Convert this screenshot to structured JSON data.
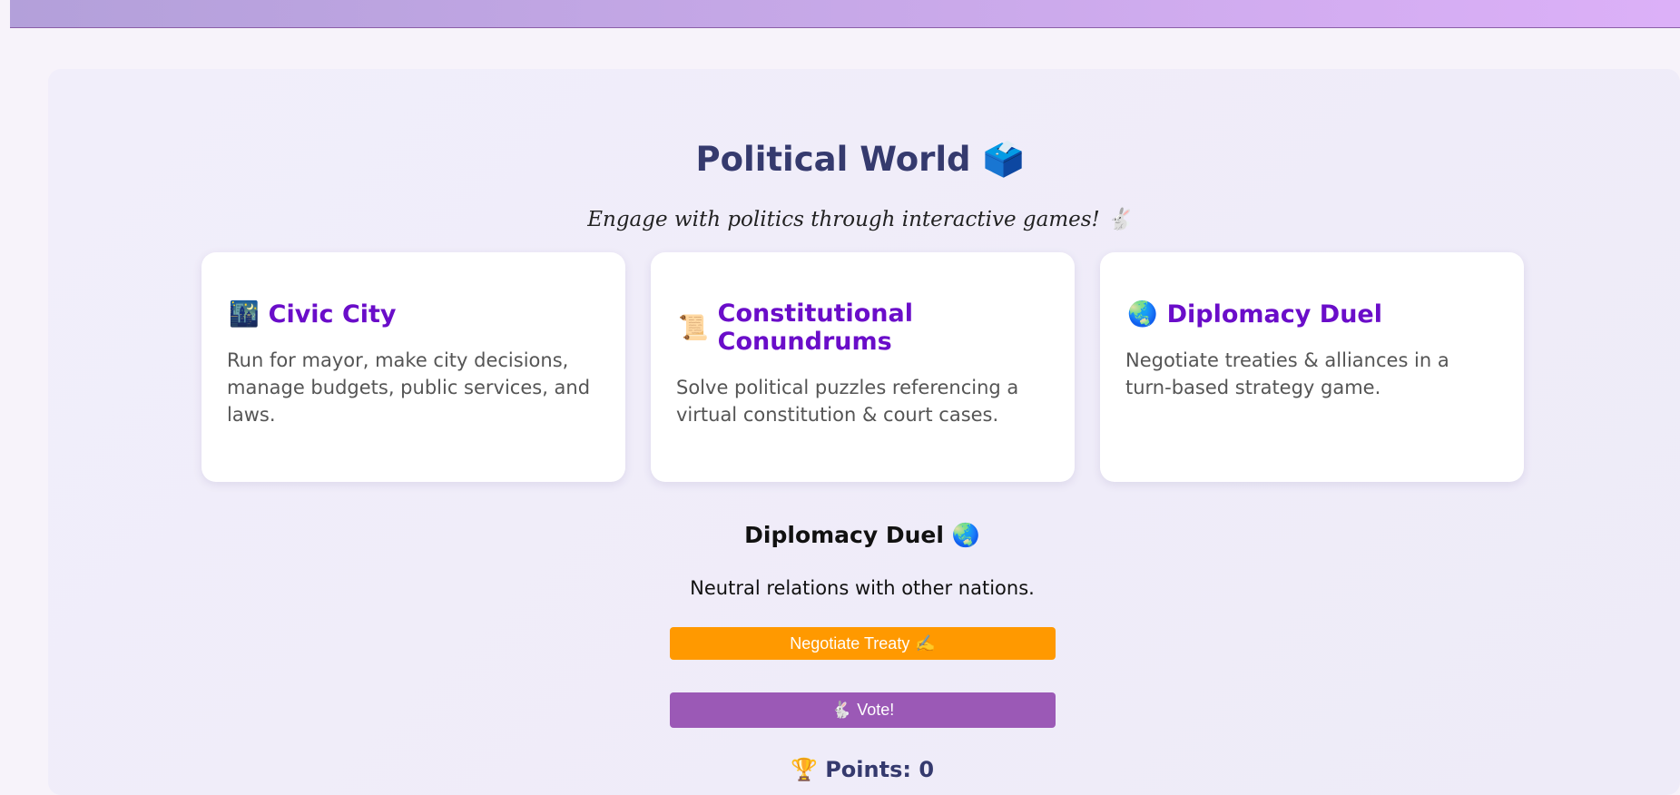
{
  "header": {
    "title": "Political World",
    "title_icon": "🗳️",
    "subtitle": "Engage with politics through interactive games!",
    "subtitle_icon": "🐇"
  },
  "games": [
    {
      "icon": "🌃",
      "title": "Civic City",
      "description": "Run for mayor, make city decisions, manage budgets, public services, and laws."
    },
    {
      "icon": "📜",
      "title": "Constitutional Conundrums",
      "description": "Solve political puzzles referencing a virtual constitution & court cases."
    },
    {
      "icon": "🌏",
      "title": "Diplomacy Duel",
      "description": "Negotiate treaties & alliances in a turn-based strategy game."
    }
  ],
  "active_game": {
    "title": "Diplomacy Duel",
    "icon": "🌏",
    "status": "Neutral relations with other nations.",
    "negotiate_label": "Negotiate Treaty",
    "negotiate_icon": "✍️",
    "vote_label": "Vote!",
    "vote_icon": "🐇"
  },
  "score": {
    "icon": "🏆",
    "label": "Points: 0"
  },
  "colors": {
    "accent": "#6a0dc9",
    "title": "#353a6e",
    "negotiate": "#ff9900",
    "vote": "#9b59b6"
  }
}
